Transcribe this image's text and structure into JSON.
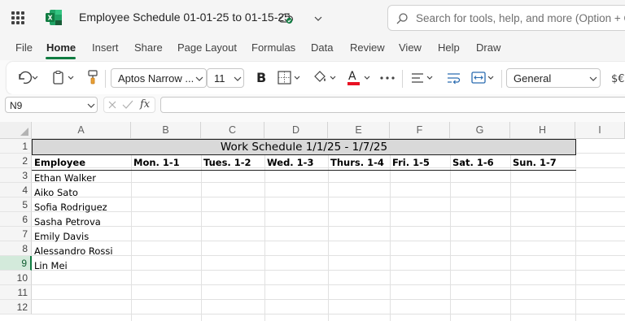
{
  "app": {
    "document_title": "Employee Schedule 01-01-25 to 01-15-25",
    "search_placeholder": "Search for tools, help, and more (Option + Q)",
    "brand_color": "#107c41"
  },
  "menu": {
    "items": [
      "File",
      "Home",
      "Insert",
      "Share",
      "Page Layout",
      "Formulas",
      "Data",
      "Review",
      "View",
      "Help",
      "Draw"
    ],
    "active": "Home"
  },
  "toolbar": {
    "font_name": "Aptos Narrow ...",
    "font_size": "11",
    "number_format": "General",
    "icons": [
      "undo-icon",
      "clipboard-icon",
      "format-painter-icon",
      "bold-icon",
      "borders-icon",
      "fill-color-icon",
      "font-color-icon",
      "more-icon",
      "align-icon",
      "wrap-text-icon",
      "merge-icon",
      "currency-icon"
    ],
    "font_color": "#e81123"
  },
  "formula_bar": {
    "name_box": "N9",
    "fx_label": "fx",
    "value": ""
  },
  "sheet": {
    "columns": [
      "A",
      "B",
      "C",
      "D",
      "E",
      "F",
      "G",
      "H",
      "I"
    ],
    "rows": [
      "1",
      "2",
      "3",
      "4",
      "5",
      "6",
      "7",
      "8",
      "9",
      "10",
      "11",
      "12"
    ],
    "selected_row": "9",
    "title": "Work Schedule 1/1/25 - 1/7/25",
    "headers": [
      "Employee",
      "Mon. 1-1",
      "Tues. 1-2",
      "Wed. 1-3",
      "Thurs. 1-4",
      "Fri. 1-5",
      "Sat. 1-6",
      "Sun. 1-7"
    ],
    "employees": [
      "Ethan Walker",
      "Aiko Sato",
      "Sofia Rodriguez",
      "Sasha Petrova",
      "Emily Davis",
      "Alessandro Rossi",
      "Lin Mei"
    ]
  }
}
